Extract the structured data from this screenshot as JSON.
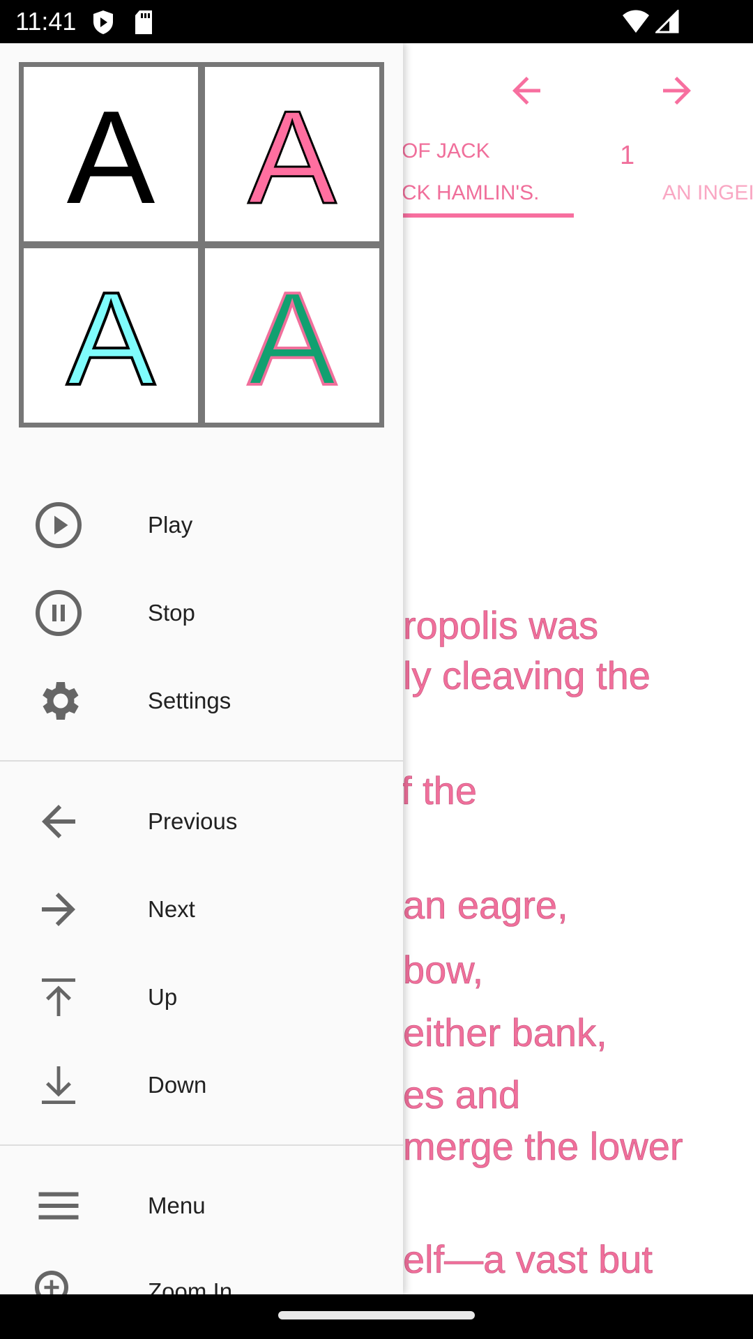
{
  "status_bar": {
    "time": "11:41",
    "icons": [
      "shield-play-icon",
      "sd-card-icon",
      "wifi-icon",
      "signal-icon"
    ]
  },
  "toolbar": {
    "icons": [
      "arrow-back-icon",
      "arrow-forward-icon"
    ],
    "accent": "#f76f9f"
  },
  "tabs": [
    {
      "label_line1": "OF JACK",
      "label_line2": "CK HAMLIN'S.",
      "selected": true
    },
    {
      "label": "1"
    },
    {
      "label": "AN INGEI"
    }
  ],
  "body_lines": [
    "ropolis was",
    "ly cleaving the",
    "f the",
    "an eagre,",
    "bow,",
    "either bank,",
    "es and",
    "merge the lower",
    "elf—a vast but"
  ],
  "drawer": {
    "font_previews": [
      {
        "letter": "A",
        "fill": "#000000",
        "stroke": "#000000"
      },
      {
        "letter": "A",
        "fill": "#ff6fa0",
        "stroke": "#000000"
      },
      {
        "letter": "A",
        "fill": "#7ffcfc",
        "stroke": "#000000"
      },
      {
        "letter": "A",
        "fill": "#11a070",
        "stroke": "#f06f9b"
      }
    ],
    "group1": [
      {
        "label": "Play",
        "icon": "play-circle-icon"
      },
      {
        "label": "Stop",
        "icon": "pause-circle-icon"
      },
      {
        "label": "Settings",
        "icon": "gear-icon"
      }
    ],
    "group2": [
      {
        "label": "Previous",
        "icon": "arrow-back-icon"
      },
      {
        "label": "Next",
        "icon": "arrow-forward-icon"
      },
      {
        "label": "Up",
        "icon": "upload-icon"
      },
      {
        "label": "Down",
        "icon": "download-icon"
      }
    ],
    "group3": [
      {
        "label": "Menu",
        "icon": "menu-icon"
      },
      {
        "label": "Zoom In",
        "icon": "zoom-in-icon"
      }
    ]
  }
}
